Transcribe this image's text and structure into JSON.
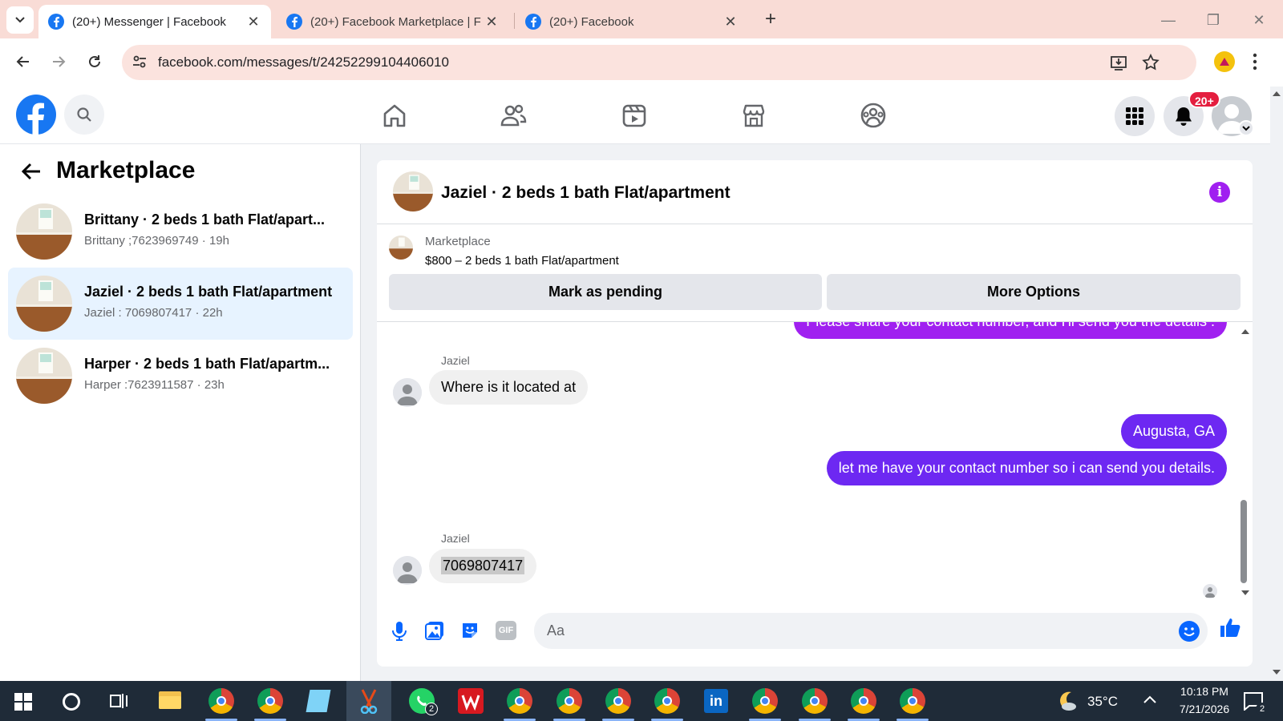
{
  "browser": {
    "tabs": [
      {
        "title": "(20+) Messenger | Facebook",
        "active": true
      },
      {
        "title": "(20+) Facebook Marketplace | F",
        "active": false
      },
      {
        "title": "(20+) Facebook",
        "active": false
      }
    ],
    "url": "facebook.com/messages/t/24252299104406010"
  },
  "header": {
    "notification_count": "20+"
  },
  "sidebar": {
    "title": "Marketplace",
    "conversations": [
      {
        "name": "Brittany · 2 beds 1 bath Flat/apart...",
        "subtitle": "Brittany ;7623969749 · 19h"
      },
      {
        "name": "Jaziel · 2 beds 1 bath Flat/apartment",
        "subtitle": "Jaziel : 7069807417 · 22h"
      },
      {
        "name": "Harper · 2 beds 1 bath Flat/apartm...",
        "subtitle": "Harper :7623911587 · 23h"
      }
    ]
  },
  "chat": {
    "title": "Jaziel · 2 beds 1 bath Flat/apartment",
    "listing_source": "Marketplace",
    "listing_title": "$800 – 2 beds 1 bath Flat/apartment",
    "mark_pending_label": "Mark as pending",
    "more_options_label": "More Options",
    "messages": [
      {
        "direction": "out",
        "text": "Please share your contact number, and I'll send you the details ."
      },
      {
        "direction": "in",
        "sender": "Jaziel",
        "text": "Where is it located at"
      },
      {
        "direction": "out",
        "text": "Augusta, GA"
      },
      {
        "direction": "out",
        "text": "let me have your contact number so i can send you details."
      },
      {
        "direction": "in",
        "sender": "Jaziel",
        "text": "7069807417"
      }
    ],
    "composer_placeholder": "Aa"
  },
  "taskbar": {
    "weather": "35°C",
    "time": "10:18 PM",
    "date": "7/21/2026",
    "whatsapp_badge": "2",
    "notification_badge": "2"
  },
  "colors": {
    "fb_blue": "#1877f2",
    "bubble_purple": "#6d28f2",
    "tab_strip": "#f9dcd6",
    "info_purple": "#a020f0"
  }
}
